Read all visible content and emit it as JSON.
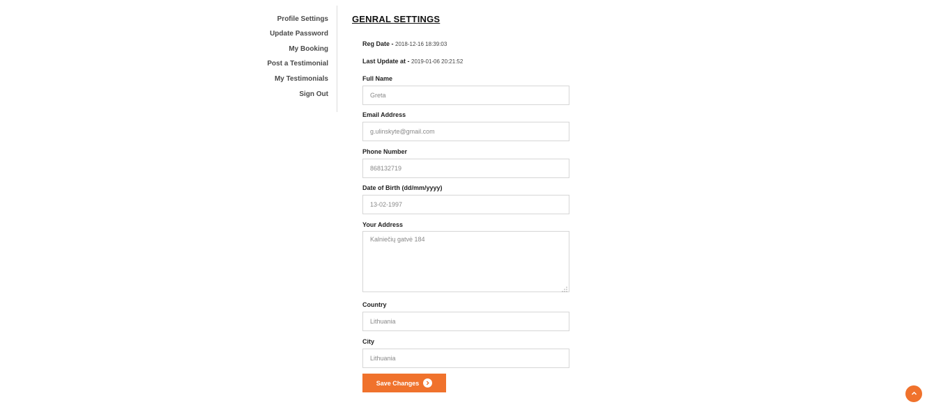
{
  "sidebar": {
    "items": [
      {
        "label": "Profile Settings"
      },
      {
        "label": "Update Password"
      },
      {
        "label": "My Booking"
      },
      {
        "label": "Post a Testimonial"
      },
      {
        "label": "My Testimonials"
      },
      {
        "label": "Sign Out"
      }
    ]
  },
  "main": {
    "title": "GENRAL SETTINGS",
    "reg_date_label": "Reg Date -",
    "reg_date_value": "2018-12-16 18:39:03",
    "last_update_label": "Last Update at -",
    "last_update_value": "2019-01-06 20:21:52"
  },
  "form": {
    "full_name": {
      "label": "Full Name",
      "value": "Greta"
    },
    "email": {
      "label": "Email Address",
      "value": "g.ulinskyte@gmail.com"
    },
    "phone": {
      "label": "Phone Number",
      "value": "868132719"
    },
    "dob": {
      "label": "Date of Birth (dd/mm/yyyy)",
      "value": "13-02-1997"
    },
    "address": {
      "label": "Your Address",
      "value": "Kalniečių gatvė 184"
    },
    "country": {
      "label": "Country",
      "value": "Lithuania"
    },
    "city": {
      "label": "City",
      "value": "Lithuania"
    },
    "save_label": "Save Changes"
  },
  "colors": {
    "accent": "#f0722c"
  },
  "icons": {
    "save_arrow": "chevron-right-circle-icon",
    "scroll_top": "chevron-up-icon"
  }
}
